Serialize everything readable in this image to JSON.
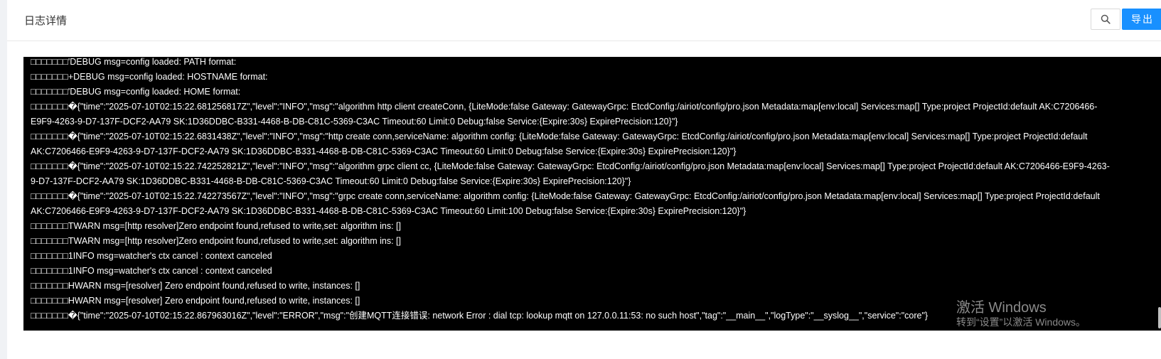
{
  "header": {
    "title": "日志详情",
    "export_label": "导出",
    "search_icon": "search-icon"
  },
  "console": {
    "lines": [
      "□□□□□□□'DEBUG msg=config loaded: PATH format:",
      "□□□□□□□+DEBUG msg=config loaded: HOSTNAME format:",
      "□□□□□□□'DEBUG msg=config loaded: HOME format:",
      "□□□□□□□�{\"time\":\"2025-07-10T02:15:22.681256817Z\",\"level\":\"INFO\",\"msg\":\"algorithm http client createConn, {LiteMode:false Gateway: GatewayGrpc: EtcdConfig:/airiot/config/pro.json Metadata:map[env:local] Services:map[] Type:project ProjectId:default AK:C7206466-E9F9-4263-9-D7-137F-DCF2-AA79 SK:1D36DDBC-B331-4468-B-DB-C81C-5369-C3AC Timeout:60 Limit:0 Debug:false Service:{Expire:30s} ExpirePrecision:120}\"}",
      "□□□□□□□�{\"time\":\"2025-07-10T02:15:22.6831438Z\",\"level\":\"INFO\",\"msg\":\"http create conn,serviceName: algorithm config: {LiteMode:false Gateway: GatewayGrpc: EtcdConfig:/airiot/config/pro.json Metadata:map[env:local] Services:map[] Type:project ProjectId:default AK:C7206466-E9F9-4263-9-D7-137F-DCF2-AA79 SK:1D36DDBC-B331-4468-B-DB-C81C-5369-C3AC Timeout:60 Limit:0 Debug:false Service:{Expire:30s} ExpirePrecision:120}\"}",
      "□□□□□□□�{\"time\":\"2025-07-10T02:15:22.742252821Z\",\"level\":\"INFO\",\"msg\":\"algorithm grpc client cc, {LiteMode:false Gateway: GatewayGrpc: EtcdConfig:/airiot/config/pro.json Metadata:map[env:local] Services:map[] Type:project ProjectId:default AK:C7206466-E9F9-4263-9-D7-137F-DCF2-AA79 SK:1D36DDBC-B331-4468-B-DB-C81C-5369-C3AC Timeout:60 Limit:0 Debug:false Service:{Expire:30s} ExpirePrecision:120}\"}",
      "□□□□□□□�{\"time\":\"2025-07-10T02:15:22.742273567Z\",\"level\":\"INFO\",\"msg\":\"grpc create conn,serviceName: algorithm config: {LiteMode:false Gateway: GatewayGrpc: EtcdConfig:/airiot/config/pro.json Metadata:map[env:local] Services:map[] Type:project ProjectId:default AK:C7206466-E9F9-4263-9-D7-137F-DCF2-AA79 SK:1D36DDBC-B331-4468-B-DB-C81C-5369-C3AC Timeout:60 Limit:100 Debug:false Service:{Expire:30s} ExpirePrecision:120}\"}",
      "□□□□□□□TWARN msg=[http resolver]Zero endpoint found,refused to write,set: algorithm ins: []",
      "□□□□□□□TWARN msg=[http resolver]Zero endpoint found,refused to write,set: algorithm ins: []",
      "□□□□□□□1INFO msg=watcher's ctx cancel : context canceled",
      "□□□□□□□1INFO msg=watcher's ctx cancel : context canceled",
      "□□□□□□□HWARN msg=[resolver] Zero endpoint found,refused to write, instances: []",
      "□□□□□□□HWARN msg=[resolver] Zero endpoint found,refused to write, instances: []",
      "□□□□□□□�{\"time\":\"2025-07-10T02:15:22.867963016Z\",\"level\":\"ERROR\",\"msg\":\"创建MQTT连接错误: network Error : dial tcp: lookup mqtt on 127.0.0.11:53: no such host\",\"tag\":\"__main__\",\"logType\":\"__syslog__\",\"service\":\"core\"}"
    ]
  },
  "watermark": {
    "title": "激活 Windows",
    "subtitle": "转到“设置”以激活 Windows。"
  }
}
